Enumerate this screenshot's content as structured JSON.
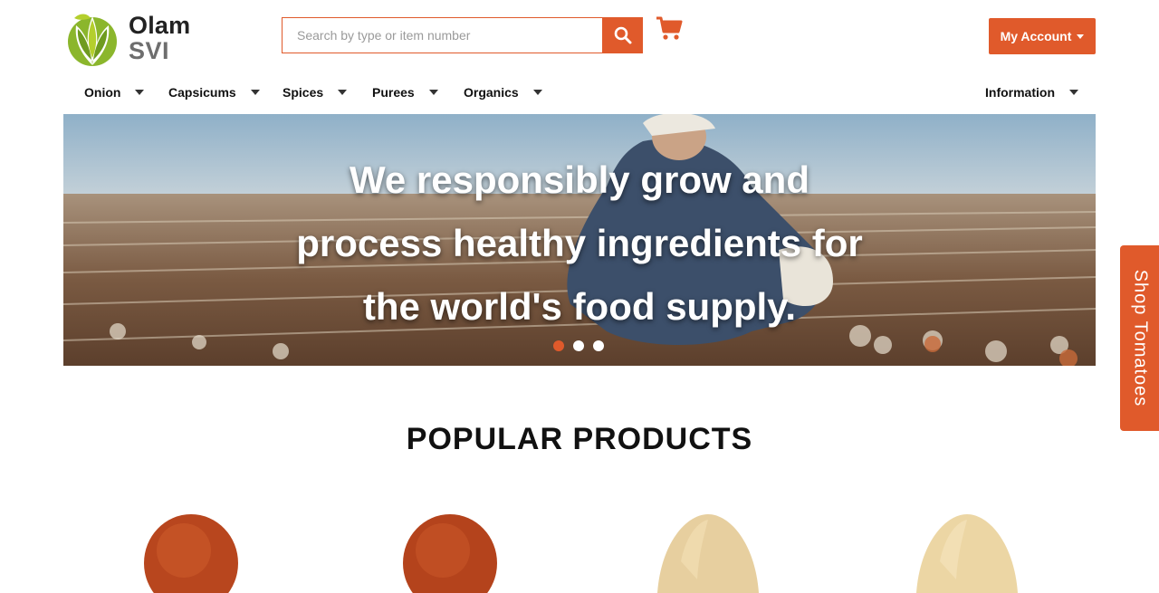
{
  "brand": {
    "line1": "Olam",
    "line2": "SVI"
  },
  "search": {
    "placeholder": "Search by type or item number"
  },
  "account": {
    "label": "My Account"
  },
  "nav": {
    "items": [
      {
        "label": "Onion"
      },
      {
        "label": "Capsicums"
      },
      {
        "label": "Spices"
      },
      {
        "label": "Purees"
      },
      {
        "label": "Organics"
      }
    ],
    "information": "Information"
  },
  "hero": {
    "headline": "We responsibly grow and process healthy ingredients for the world's food supply.",
    "slides_total": 3,
    "active_slide": 1
  },
  "side_tab": {
    "label": "Shop Tomatoes"
  },
  "popular": {
    "title": "POPULAR PRODUCTS"
  },
  "colors": {
    "accent": "#e05a2b",
    "logo_green": "#7aa82a",
    "logo_lime": "#b4cf2d"
  },
  "icons": [
    "search-icon",
    "cart-icon",
    "chevron-down-icon"
  ]
}
